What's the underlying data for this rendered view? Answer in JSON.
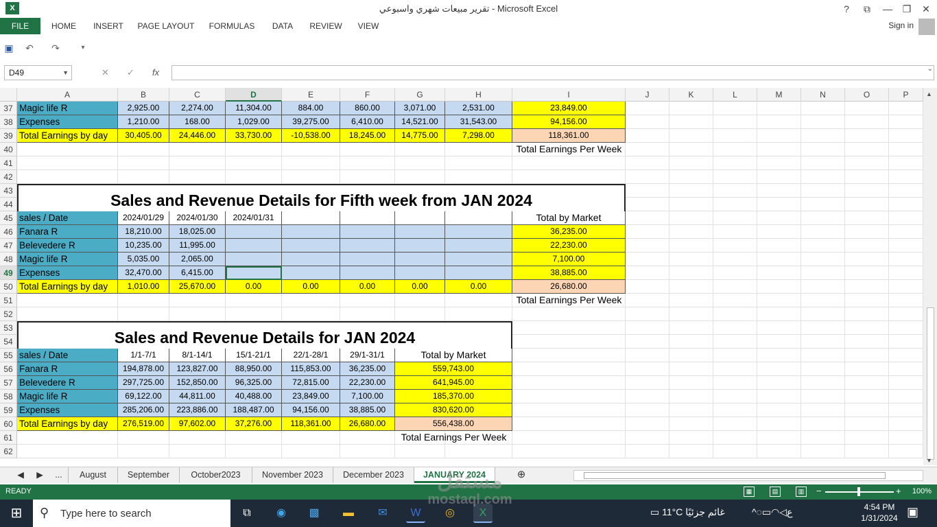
{
  "window": {
    "title": "تقرير مبيعات شهري واسبوعي - Microsoft Excel",
    "help": "?",
    "restore_ribbon": "⧉",
    "minimize": "—",
    "restore": "❐",
    "close": "✕",
    "app_icon": "X"
  },
  "ribbon": {
    "tabs": [
      "FILE",
      "HOME",
      "INSERT",
      "PAGE LAYOUT",
      "FORMULAS",
      "DATA",
      "REVIEW",
      "VIEW"
    ],
    "sign_in": "Sign in"
  },
  "formula_bar": {
    "name_box": "D49",
    "formula": ""
  },
  "grid": {
    "columns": [
      "A",
      "B",
      "C",
      "D",
      "E",
      "F",
      "G",
      "H",
      "I",
      "J",
      "K",
      "L",
      "M",
      "N",
      "O",
      "P"
    ],
    "active_column": "D",
    "active_row": "49",
    "rows": [
      "37",
      "38",
      "39",
      "40",
      "41",
      "42",
      "43",
      "44",
      "45",
      "46",
      "47",
      "48",
      "49",
      "50",
      "51",
      "52",
      "53",
      "54",
      "55",
      "56",
      "57",
      "58",
      "59",
      "60",
      "61",
      "62"
    ],
    "week4": {
      "rows": [
        {
          "label": "Magic life R",
          "values": [
            "2,925.00",
            "2,274.00",
            "11,304.00",
            "884.00",
            "860.00",
            "3,071.00",
            "2,531.00"
          ],
          "total": "23,849.00"
        },
        {
          "label": "Expenses",
          "values": [
            "1,210.00",
            "168.00",
            "1,029.00",
            "39,275.00",
            "6,410.00",
            "14,521.00",
            "31,543.00"
          ],
          "total": "94,156.00"
        },
        {
          "label": "Total Earnings by day",
          "values": [
            "30,405.00",
            "24,446.00",
            "33,730.00",
            "-10,538.00",
            "18,245.00",
            "14,775.00",
            "7,298.00"
          ],
          "total": "118,361.00"
        }
      ],
      "footer": "Total Earnings Per Week"
    },
    "week5": {
      "title": "Sales and Revenue Details for Fifth week from JAN  2024",
      "header_label": "sales / Date",
      "dates": [
        "2024/01/29",
        "2024/01/30",
        "2024/01/31",
        "",
        "",
        "",
        ""
      ],
      "total_header": "Total by Market",
      "rows": [
        {
          "label": "Fanara R",
          "values": [
            "18,210.00",
            "18,025.00",
            "",
            "",
            "",
            "",
            ""
          ],
          "total": "36,235.00"
        },
        {
          "label": "Belevedere R",
          "values": [
            "10,235.00",
            "11,995.00",
            "",
            "",
            "",
            "",
            ""
          ],
          "total": "22,230.00"
        },
        {
          "label": "Magic life R",
          "values": [
            "5,035.00",
            "2,065.00",
            "",
            "",
            "",
            "",
            ""
          ],
          "total": "7,100.00"
        },
        {
          "label": "Expenses",
          "values": [
            "32,470.00",
            "6,415.00",
            "",
            "",
            "",
            "",
            ""
          ],
          "total": "38,885.00"
        },
        {
          "label": "Total Earnings by day",
          "values": [
            "1,010.00",
            "25,670.00",
            "0.00",
            "0.00",
            "0.00",
            "0.00",
            "0.00"
          ],
          "total": "26,680.00"
        }
      ],
      "footer": "Total Earnings Per Week"
    },
    "month": {
      "title": "Sales and Revenue Details for JAN  2024",
      "header_label": "sales / Date",
      "periods": [
        "1/1-7/1",
        "8/1-14/1",
        "15/1-21/1",
        "22/1-28/1",
        "29/1-31/1"
      ],
      "total_header": "Total by Market",
      "rows": [
        {
          "label": "Fanara R",
          "values": [
            "194,878.00",
            "123,827.00",
            "88,950.00",
            "115,853.00",
            "36,235.00"
          ],
          "total": "559,743.00"
        },
        {
          "label": "Belevedere R",
          "values": [
            "297,725.00",
            "152,850.00",
            "96,325.00",
            "72,815.00",
            "22,230.00"
          ],
          "total": "641,945.00"
        },
        {
          "label": "Magic life R",
          "values": [
            "69,122.00",
            "44,811.00",
            "40,488.00",
            "23,849.00",
            "7,100.00"
          ],
          "total": "185,370.00"
        },
        {
          "label": "Expenses",
          "values": [
            "285,206.00",
            "223,886.00",
            "188,487.00",
            "94,156.00",
            "38,885.00"
          ],
          "total": "830,620.00"
        },
        {
          "label": "Total Earnings by day",
          "values": [
            "276,519.00",
            "97,602.00",
            "37,276.00",
            "118,361.00",
            "26,680.00"
          ],
          "total": "556,438.00"
        }
      ],
      "footer": "Total Earnings Per Week"
    }
  },
  "sheets": {
    "nav_prev": "◀",
    "nav_next": "▶",
    "more": "...",
    "tabs": [
      "August",
      "September",
      "October2023",
      "November 2023",
      "December 2023",
      "JANUARY 2024"
    ],
    "active": "JANUARY 2024",
    "add": "⊕"
  },
  "status": {
    "ready": "READY",
    "zoom": "100%",
    "minus": "−",
    "plus": "+"
  },
  "taskbar": {
    "search_placeholder": "Type here to search",
    "weather_temp": "11°C",
    "weather_text": "غائم جزئيًا",
    "lang": "ع",
    "time": "4:54 PM",
    "date": "1/31/2024"
  },
  "watermark": {
    "arabic": "مستقل",
    "latin": "mostaql.com"
  },
  "colors": {
    "excel_green": "#217346",
    "label_blue": "#4bacc6",
    "data_blue": "#c5d9f1",
    "total_yellow": "#ffff00",
    "grand_total_peach": "#fcd5b4"
  }
}
